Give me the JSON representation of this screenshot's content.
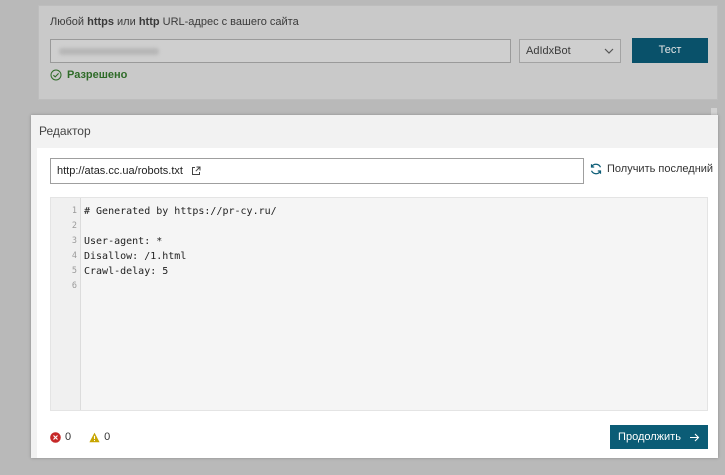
{
  "test_panel": {
    "label_prefix": "Любой ",
    "label_https": "https",
    "label_or": " или ",
    "label_http": "http",
    "label_suffix": " URL-адрес с вашего сайта",
    "bot_select_value": "AdIdxBot",
    "test_button": "Тест",
    "status": "Разрешено"
  },
  "editor": {
    "title": "Редактор",
    "robots_url": "http://atas.cc.ua/robots.txt",
    "fetch_latest": "Получить последний",
    "lines": [
      {
        "n": "1",
        "text": "# Generated by https://pr-cy.ru/"
      },
      {
        "n": "2",
        "text": ""
      },
      {
        "n": "3",
        "text": "User-agent: *"
      },
      {
        "n": "4",
        "text": "Disallow: /1.html"
      },
      {
        "n": "5",
        "text": "Crawl-delay: 5"
      },
      {
        "n": "6",
        "text": ""
      }
    ],
    "errors_count": "0",
    "warnings_count": "0",
    "continue_button": "Продолжить"
  },
  "colors": {
    "primary": "#0b5c76",
    "success": "#2e6b28",
    "error": "#c62828",
    "warning": "#c7a500"
  }
}
